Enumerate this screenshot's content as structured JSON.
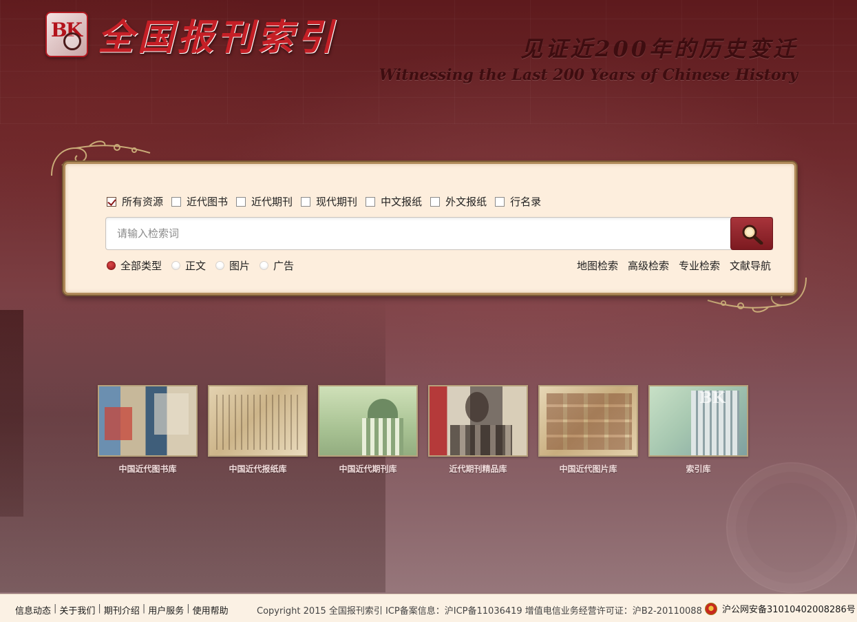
{
  "header": {
    "logo_text": "全国报刊索引",
    "logo_badge": "BK",
    "slogan_cn": "见证近200年的历史变迁",
    "slogan_en": "Witnessing the Last 200 Years of Chinese History"
  },
  "search": {
    "resources": [
      {
        "label": "所有资源",
        "checked": true
      },
      {
        "label": "近代图书",
        "checked": false
      },
      {
        "label": "近代期刊",
        "checked": false
      },
      {
        "label": "现代期刊",
        "checked": false
      },
      {
        "label": "中文报纸",
        "checked": false
      },
      {
        "label": "外文报纸",
        "checked": false
      },
      {
        "label": "行名录",
        "checked": false
      }
    ],
    "placeholder": "请输入检索词",
    "value": "",
    "types": [
      {
        "label": "全部类型",
        "selected": true
      },
      {
        "label": "正文",
        "selected": false
      },
      {
        "label": "图片",
        "selected": false
      },
      {
        "label": "广告",
        "selected": false
      }
    ],
    "links": [
      "地图检索",
      "高级检索",
      "专业检索",
      "文献导航"
    ]
  },
  "databases": [
    {
      "label": "中国近代图书库"
    },
    {
      "label": "中国近代报纸库"
    },
    {
      "label": "中国近代期刊库"
    },
    {
      "label": "近代期刊精品库"
    },
    {
      "label": "中国近代图片库"
    },
    {
      "label": "索引库"
    }
  ],
  "footer": {
    "links": [
      "信息动态",
      "关于我们",
      "期刊介绍",
      "用户服务",
      "使用帮助"
    ],
    "separator": "|",
    "copyright": "Copyright 2015 全国报刊索引 ICP备案信息：沪ICP备11036419 增值电信业务经营许可证：沪B2-20110088",
    "police_record": "沪公网安备31010402008286号"
  },
  "colors": {
    "brand_red": "#c51f26",
    "panel_bg": "#fdeedd",
    "footer_bg": "#fbf1e4",
    "search_button": "#8e242a"
  },
  "icons": {
    "search_button": "magnifier-icon",
    "police": "police-badge-icon"
  }
}
